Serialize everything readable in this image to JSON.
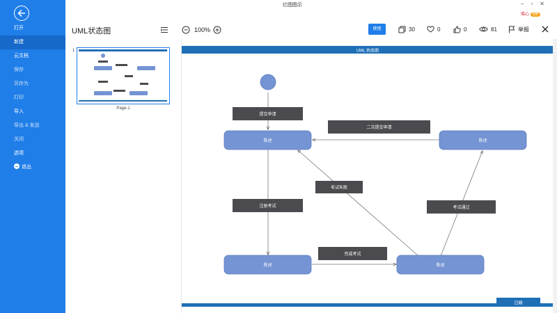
{
  "window": {
    "title": "亿图图示",
    "user_name": "瑶心",
    "vip_badge": "VIP"
  },
  "sidebar": {
    "items": [
      {
        "label": "打开",
        "state": "normal"
      },
      {
        "label": "新建",
        "state": "active"
      },
      {
        "label": "云文档",
        "state": "normal"
      },
      {
        "label": "保存",
        "state": "dim"
      },
      {
        "label": "另存为",
        "state": "dim"
      },
      {
        "label": "打印",
        "state": "dim"
      },
      {
        "label": "导入",
        "state": "normal"
      },
      {
        "label": "导出 & 发送",
        "state": "dim"
      },
      {
        "label": "关闭",
        "state": "dim"
      },
      {
        "label": "选项",
        "state": "normal"
      },
      {
        "label": "退出",
        "state": "normal"
      }
    ]
  },
  "toolbar": {
    "doc_title": "UML状态图",
    "zoom_level": "100%",
    "use_label": "使用",
    "copies_count": "30",
    "favorites_count": "0",
    "likes_count": "0",
    "views_count": "81",
    "report_label": "举报"
  },
  "pages": [
    {
      "number": "1",
      "name": "Page-1"
    }
  ],
  "diagram": {
    "header_text": "UML 状态图",
    "footer_text": "日期",
    "states": [
      {
        "id": "s1",
        "label": "陈述"
      },
      {
        "id": "s2",
        "label": "陈述"
      },
      {
        "id": "s3",
        "label": "陈述"
      },
      {
        "id": "s4",
        "label": "陈述"
      }
    ],
    "transitions": [
      {
        "id": "t1",
        "label": "提交申请"
      },
      {
        "id": "t2",
        "label": "二次提交申请"
      },
      {
        "id": "t3",
        "label": "考试失败"
      },
      {
        "id": "t4",
        "label": "注册考试"
      },
      {
        "id": "t5",
        "label": "考试通过"
      },
      {
        "id": "t6",
        "label": "完成考试"
      }
    ]
  },
  "colors": {
    "accent": "#1f7ee8",
    "state_fill": "#7494d3",
    "label_fill": "#4a4a4f",
    "band": "#1f6fb7"
  }
}
